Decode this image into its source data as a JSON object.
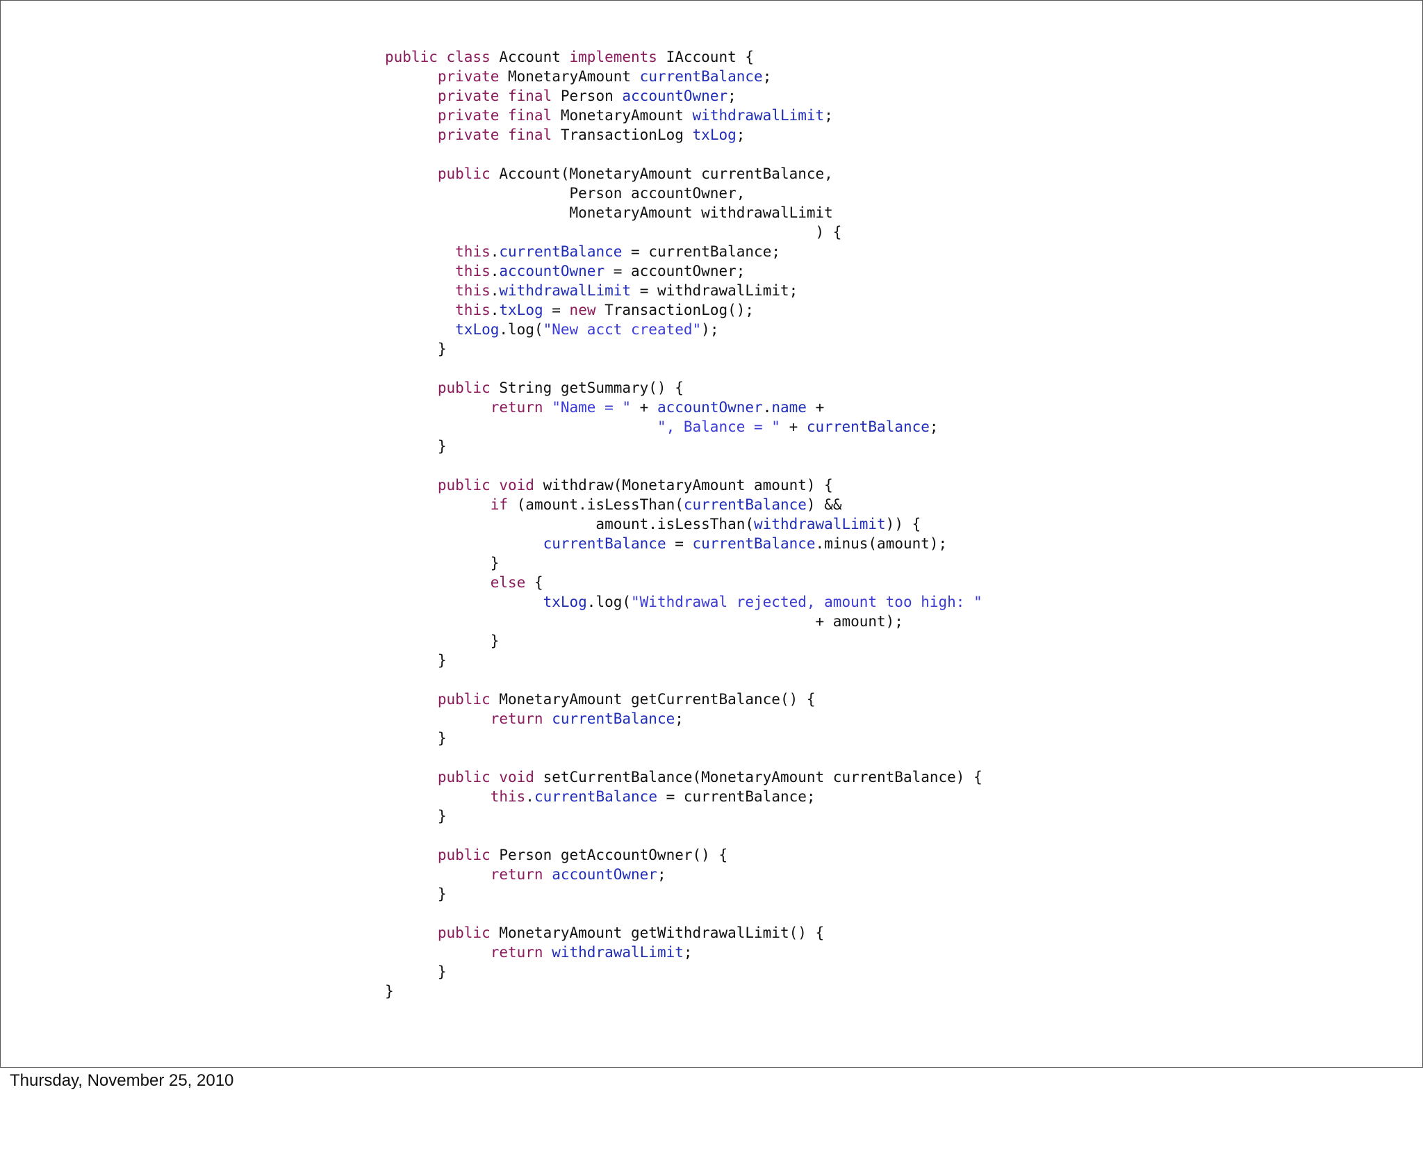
{
  "footer": {
    "date": "Thursday, November 25, 2010"
  },
  "colors": {
    "keyword": "#8c1a5c",
    "field": "#1f2db8",
    "string": "#3a3ad6",
    "plain": "#111111"
  },
  "code_lines": [
    [
      [
        "k",
        "public class"
      ],
      [
        "p",
        " Account "
      ],
      [
        "k",
        "implements"
      ],
      [
        "p",
        " IAccount {"
      ]
    ],
    [
      [
        "p",
        "      "
      ],
      [
        "k",
        "private"
      ],
      [
        "p",
        " MonetaryAmount "
      ],
      [
        "f",
        "currentBalance"
      ],
      [
        "p",
        ";"
      ]
    ],
    [
      [
        "p",
        "      "
      ],
      [
        "k",
        "private final"
      ],
      [
        "p",
        " Person "
      ],
      [
        "f",
        "accountOwner"
      ],
      [
        "p",
        ";"
      ]
    ],
    [
      [
        "p",
        "      "
      ],
      [
        "k",
        "private final"
      ],
      [
        "p",
        " MonetaryAmount "
      ],
      [
        "f",
        "withdrawalLimit"
      ],
      [
        "p",
        ";"
      ]
    ],
    [
      [
        "p",
        "      "
      ],
      [
        "k",
        "private final"
      ],
      [
        "p",
        " TransactionLog "
      ],
      [
        "f",
        "txLog"
      ],
      [
        "p",
        ";"
      ]
    ],
    [],
    [
      [
        "p",
        "      "
      ],
      [
        "k",
        "public"
      ],
      [
        "p",
        " Account(MonetaryAmount currentBalance,"
      ]
    ],
    [
      [
        "p",
        "                     Person accountOwner,"
      ]
    ],
    [
      [
        "p",
        "                     MonetaryAmount withdrawalLimit"
      ]
    ],
    [
      [
        "p",
        "                                                 ) {"
      ]
    ],
    [
      [
        "p",
        "        "
      ],
      [
        "k",
        "this"
      ],
      [
        "p",
        "."
      ],
      [
        "f",
        "currentBalance"
      ],
      [
        "p",
        " = currentBalance;"
      ]
    ],
    [
      [
        "p",
        "        "
      ],
      [
        "k",
        "this"
      ],
      [
        "p",
        "."
      ],
      [
        "f",
        "accountOwner"
      ],
      [
        "p",
        " = accountOwner;"
      ]
    ],
    [
      [
        "p",
        "        "
      ],
      [
        "k",
        "this"
      ],
      [
        "p",
        "."
      ],
      [
        "f",
        "withdrawalLimit"
      ],
      [
        "p",
        " = withdrawalLimit;"
      ]
    ],
    [
      [
        "p",
        "        "
      ],
      [
        "k",
        "this"
      ],
      [
        "p",
        "."
      ],
      [
        "f",
        "txLog"
      ],
      [
        "p",
        " = "
      ],
      [
        "k",
        "new"
      ],
      [
        "p",
        " TransactionLog();"
      ]
    ],
    [
      [
        "p",
        "        "
      ],
      [
        "f",
        "txLog"
      ],
      [
        "p",
        ".log("
      ],
      [
        "s",
        "\"New acct created\""
      ],
      [
        "p",
        ");"
      ]
    ],
    [
      [
        "p",
        "      }"
      ]
    ],
    [],
    [
      [
        "p",
        "      "
      ],
      [
        "k",
        "public"
      ],
      [
        "p",
        " String getSummary() {"
      ]
    ],
    [
      [
        "p",
        "            "
      ],
      [
        "k",
        "return"
      ],
      [
        "p",
        " "
      ],
      [
        "s",
        "\"Name = \""
      ],
      [
        "p",
        " + "
      ],
      [
        "f",
        "accountOwner"
      ],
      [
        "p",
        "."
      ],
      [
        "f",
        "name"
      ],
      [
        "p",
        " +"
      ]
    ],
    [
      [
        "p",
        "                               "
      ],
      [
        "s",
        "\", Balance = \""
      ],
      [
        "p",
        " + "
      ],
      [
        "f",
        "currentBalance"
      ],
      [
        "p",
        ";"
      ]
    ],
    [
      [
        "p",
        "      }"
      ]
    ],
    [],
    [
      [
        "p",
        "      "
      ],
      [
        "k",
        "public void"
      ],
      [
        "p",
        " withdraw(MonetaryAmount amount) {"
      ]
    ],
    [
      [
        "p",
        "            "
      ],
      [
        "k",
        "if"
      ],
      [
        "p",
        " (amount.isLessThan("
      ],
      [
        "f",
        "currentBalance"
      ],
      [
        "p",
        ") &&"
      ]
    ],
    [
      [
        "p",
        "                        amount.isLessThan("
      ],
      [
        "f",
        "withdrawalLimit"
      ],
      [
        "p",
        ")) {"
      ]
    ],
    [
      [
        "p",
        "                  "
      ],
      [
        "f",
        "currentBalance"
      ],
      [
        "p",
        " = "
      ],
      [
        "f",
        "currentBalance"
      ],
      [
        "p",
        ".minus(amount);"
      ]
    ],
    [
      [
        "p",
        "            }"
      ]
    ],
    [
      [
        "p",
        "            "
      ],
      [
        "k",
        "else"
      ],
      [
        "p",
        " {"
      ]
    ],
    [
      [
        "p",
        "                  "
      ],
      [
        "f",
        "txLog"
      ],
      [
        "p",
        ".log("
      ],
      [
        "s",
        "\"Withdrawal rejected, amount too high: \""
      ]
    ],
    [
      [
        "p",
        "                                                 + amount);"
      ]
    ],
    [
      [
        "p",
        "            }"
      ]
    ],
    [
      [
        "p",
        "      }"
      ]
    ],
    [],
    [
      [
        "p",
        "      "
      ],
      [
        "k",
        "public"
      ],
      [
        "p",
        " MonetaryAmount getCurrentBalance() {"
      ]
    ],
    [
      [
        "p",
        "            "
      ],
      [
        "k",
        "return"
      ],
      [
        "p",
        " "
      ],
      [
        "f",
        "currentBalance"
      ],
      [
        "p",
        ";"
      ]
    ],
    [
      [
        "p",
        "      }"
      ]
    ],
    [],
    [
      [
        "p",
        "      "
      ],
      [
        "k",
        "public void"
      ],
      [
        "p",
        " setCurrentBalance(MonetaryAmount currentBalance) {"
      ]
    ],
    [
      [
        "p",
        "            "
      ],
      [
        "k",
        "this"
      ],
      [
        "p",
        "."
      ],
      [
        "f",
        "currentBalance"
      ],
      [
        "p",
        " = currentBalance;"
      ]
    ],
    [
      [
        "p",
        "      }"
      ]
    ],
    [],
    [
      [
        "p",
        "      "
      ],
      [
        "k",
        "public"
      ],
      [
        "p",
        " Person getAccountOwner() {"
      ]
    ],
    [
      [
        "p",
        "            "
      ],
      [
        "k",
        "return"
      ],
      [
        "p",
        " "
      ],
      [
        "f",
        "accountOwner"
      ],
      [
        "p",
        ";"
      ]
    ],
    [
      [
        "p",
        "      }"
      ]
    ],
    [],
    [
      [
        "p",
        "      "
      ],
      [
        "k",
        "public"
      ],
      [
        "p",
        " MonetaryAmount getWithdrawalLimit() {"
      ]
    ],
    [
      [
        "p",
        "            "
      ],
      [
        "k",
        "return"
      ],
      [
        "p",
        " "
      ],
      [
        "f",
        "withdrawalLimit"
      ],
      [
        "p",
        ";"
      ]
    ],
    [
      [
        "p",
        "      }"
      ]
    ],
    [
      [
        "p",
        "}"
      ]
    ]
  ]
}
